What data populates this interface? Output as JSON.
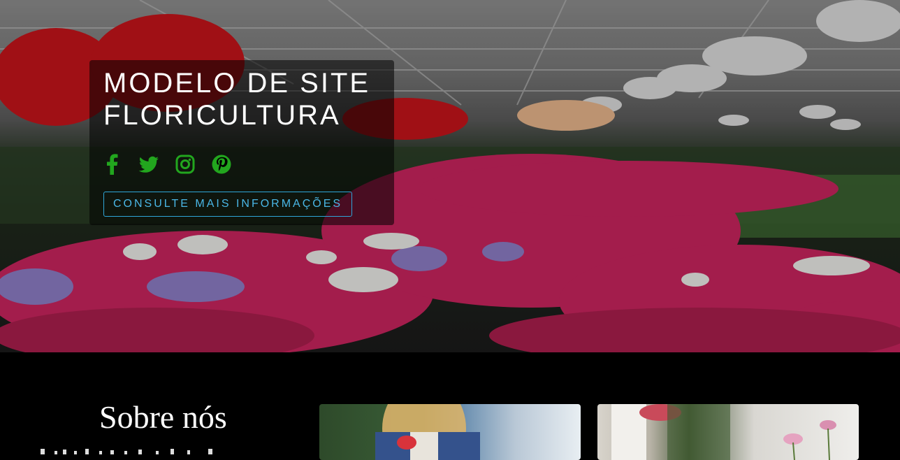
{
  "hero": {
    "title": "MODELO DE SITE FLORICULTURA",
    "cta_label": "CONSULTE MAIS INFORMAÇÕES",
    "social_icons": [
      "facebook-icon",
      "twitter-icon",
      "instagram-icon",
      "pinterest-icon"
    ]
  },
  "about": {
    "title": "Sobre nós"
  },
  "colors": {
    "social_green": "#22a61e",
    "cta_blue": "#4ab7e6",
    "page_bg": "#000000"
  }
}
